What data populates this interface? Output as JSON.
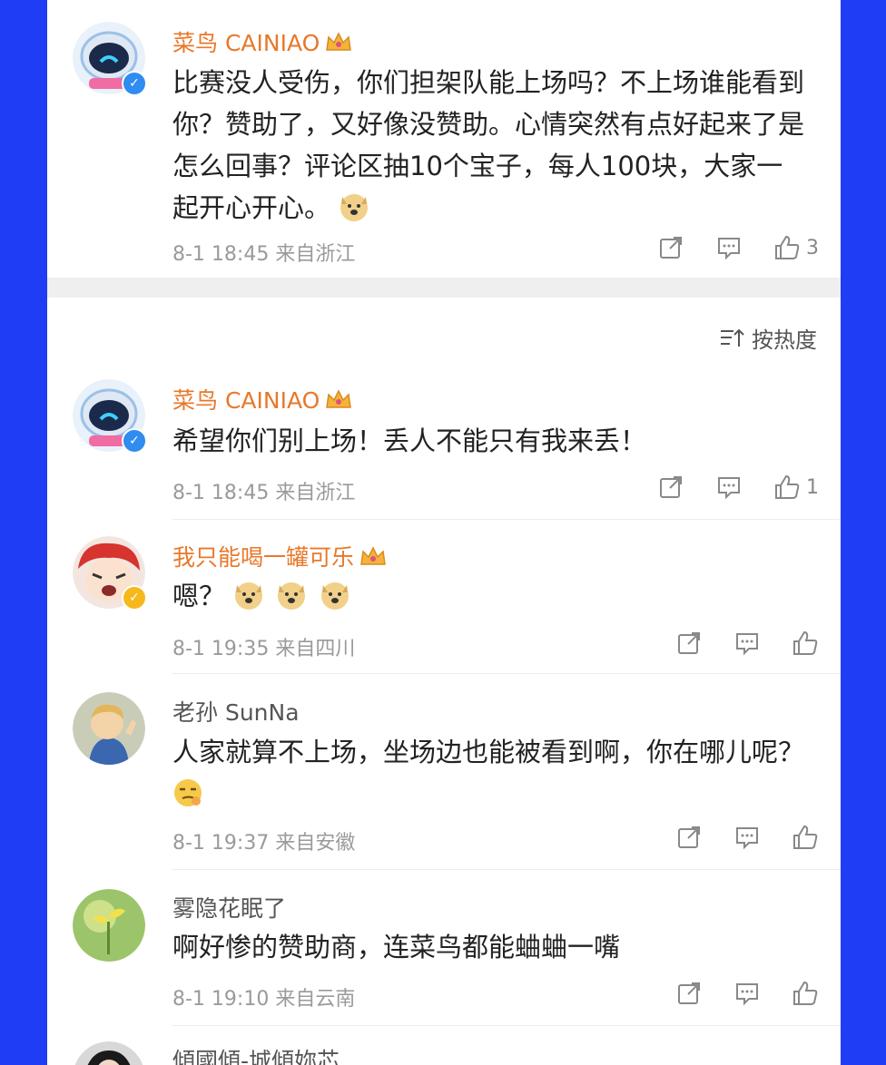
{
  "sort": {
    "label": "按热度"
  },
  "comments": [
    {
      "name": "菜鸟 CAINIAO",
      "text": "比赛没人受伤，你们担架队能上场吗？不上场谁能看到你？赞助了，又好像没赞助。心情突然有点好起来了是怎么回事？评论区抽10个宝子，每人100块，大家一起开心开心。",
      "time": "8-1 18:45",
      "location": "来自浙江",
      "likes": "3"
    },
    {
      "name": "菜鸟 CAINIAO",
      "text": "希望你们别上场！丢人不能只有我来丢！",
      "time": "8-1 18:45",
      "location": "来自浙江",
      "likes": "1"
    },
    {
      "name": "我只能喝一罐可乐",
      "text": "嗯？",
      "time": "8-1 19:35",
      "location": "来自四川"
    },
    {
      "name": "老孙 SunNa",
      "text": "人家就算不上场，坐场边也能被看到啊，你在哪儿呢？",
      "time": "8-1 19:37",
      "location": "来自安徽"
    },
    {
      "name": "雾隐花眠了",
      "text": "啊好惨的赞助商，连菜鸟都能蛐蛐一嘴",
      "time": "8-1 19:10",
      "location": "来自云南"
    },
    {
      "name": "傾國傾-城傾妳芯"
    }
  ]
}
